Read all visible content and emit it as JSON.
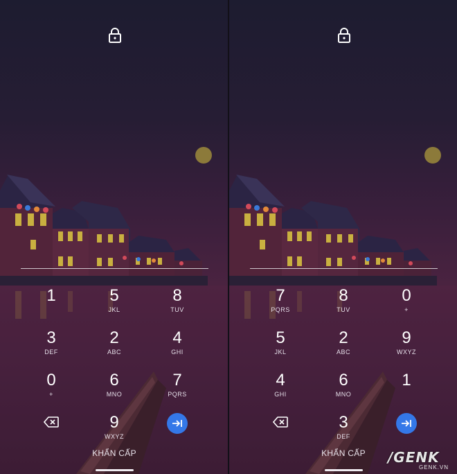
{
  "left": {
    "keys": [
      {
        "digit": "1",
        "letters": ""
      },
      {
        "digit": "5",
        "letters": "JKL"
      },
      {
        "digit": "8",
        "letters": "TUV"
      },
      {
        "digit": "3",
        "letters": "DEF"
      },
      {
        "digit": "2",
        "letters": "ABC"
      },
      {
        "digit": "4",
        "letters": "GHI"
      },
      {
        "digit": "0",
        "letters": "+"
      },
      {
        "digit": "6",
        "letters": "MNO"
      },
      {
        "digit": "7",
        "letters": "PQRS"
      },
      {
        "digit": "9",
        "letters": "WXYZ"
      }
    ],
    "emergency_label": "KHẨN CẤP"
  },
  "right": {
    "keys": [
      {
        "digit": "7",
        "letters": "PQRS"
      },
      {
        "digit": "8",
        "letters": "TUV"
      },
      {
        "digit": "0",
        "letters": "+"
      },
      {
        "digit": "5",
        "letters": "JKL"
      },
      {
        "digit": "2",
        "letters": "ABC"
      },
      {
        "digit": "9",
        "letters": "WXYZ"
      },
      {
        "digit": "4",
        "letters": "GHI"
      },
      {
        "digit": "6",
        "letters": "MNO"
      },
      {
        "digit": "1",
        "letters": ""
      },
      {
        "digit": "3",
        "letters": "DEF"
      }
    ],
    "emergency_label": "KHẨN CẤP"
  },
  "watermark": {
    "main": "/GENK",
    "sub": "GENK.VN"
  },
  "colors": {
    "enter_button": "#3478e8",
    "pin_line": "#cfc7cf",
    "moon": "#8c7a3a"
  },
  "icons": {
    "top": "lock-icon",
    "bottom_left": "backspace-icon",
    "bottom_right": "enter-icon"
  }
}
